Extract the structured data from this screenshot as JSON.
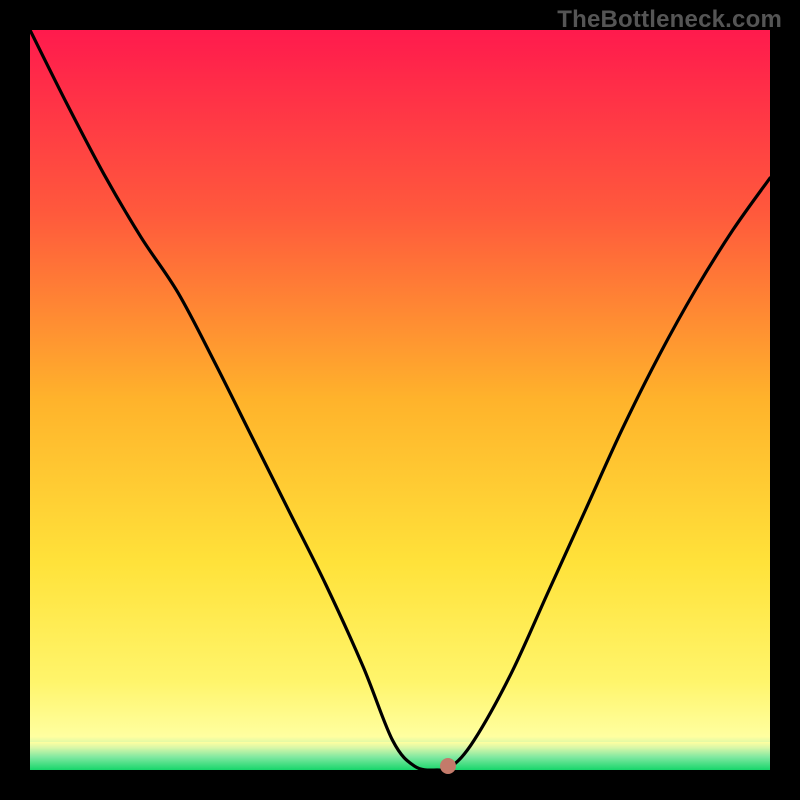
{
  "watermark": {
    "text": "TheBottleneck.com"
  },
  "chart_data": {
    "type": "line",
    "title": "",
    "xlabel": "",
    "ylabel": "",
    "xlim": [
      0,
      100
    ],
    "ylim": [
      0,
      100
    ],
    "grid": false,
    "legend": false,
    "background_gradient": {
      "stops": [
        {
          "pos": 0.0,
          "color": "#ff1a4d"
        },
        {
          "pos": 0.25,
          "color": "#ff5a3c"
        },
        {
          "pos": 0.5,
          "color": "#ffb32b"
        },
        {
          "pos": 0.72,
          "color": "#ffe23a"
        },
        {
          "pos": 0.88,
          "color": "#fff56b"
        },
        {
          "pos": 0.955,
          "color": "#ffffa0"
        },
        {
          "pos": 0.965,
          "color": "#d8f7a8"
        },
        {
          "pos": 0.985,
          "color": "#5fe08a"
        },
        {
          "pos": 1.0,
          "color": "#17d66b"
        }
      ]
    },
    "curve": {
      "x": [
        0,
        5,
        10,
        15,
        20,
        25,
        30,
        35,
        40,
        45,
        49,
        52,
        55,
        57,
        60,
        65,
        70,
        75,
        80,
        85,
        90,
        95,
        100
      ],
      "y": [
        100,
        90,
        80.5,
        72,
        64.5,
        55,
        45,
        35,
        25,
        14,
        4,
        0.5,
        0,
        0.5,
        4,
        13,
        24,
        35,
        46,
        56,
        65,
        73,
        80
      ]
    },
    "flat_bottom_range": {
      "x_start": 52,
      "x_end": 56,
      "y": 0
    },
    "marker": {
      "x": 56.5,
      "y": 0.5,
      "color": "#c47a6a"
    }
  }
}
